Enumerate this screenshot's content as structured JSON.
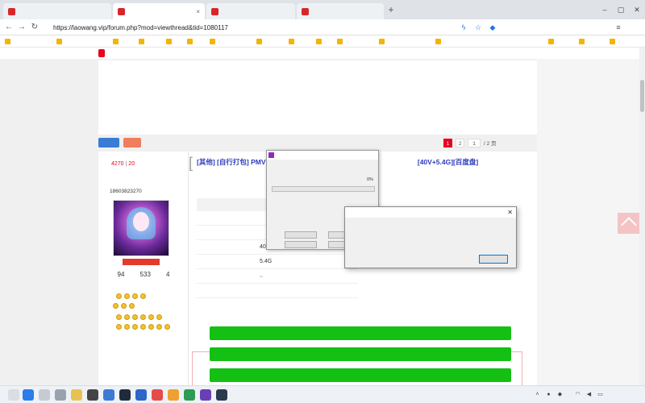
{
  "tabs": [
    {
      "title": ""
    },
    {
      "title": ""
    },
    {
      "title": ""
    },
    {
      "title": ""
    }
  ],
  "address": {
    "security": "",
    "url": "https://laowang.vip/forum.php?mod=viewthread&tid=1080117"
  },
  "bookmarks": [
    "",
    "",
    "",
    "",
    "",
    "",
    "",
    "",
    "",
    "",
    "",
    "",
    "",
    "",
    "",
    ""
  ],
  "site_nav": [
    "",
    "",
    "",
    "",
    "",
    "",
    "",
    "",
    "",
    "",
    "",
    "",
    "",
    "",
    "",
    "",
    "",
    ""
  ],
  "notice": {
    "lines": [
      "",
      "",
      "",
      "",
      ""
    ]
  },
  "actions": {
    "post": "",
    "reply": ""
  },
  "pager": {
    "back": "",
    "pages": [
      "1",
      "2"
    ],
    "input": "1",
    "total": "/ 2 页",
    "next": ""
  },
  "post": {
    "views_label": "",
    "views": "4270",
    "replies_label": "",
    "replies": "20",
    "tag": "[其他]",
    "title": "[自行打包] PMV",
    "title_tail": "[40V+5.4G][百度盘]",
    "copy_link": "",
    "author_id": "18603823270",
    "level": "",
    "user_stats": [
      {
        "value": "94",
        "label": ""
      },
      {
        "value": "533",
        "label": ""
      },
      {
        "value": "4",
        "label": ""
      }
    ],
    "meta": "",
    "floor": ""
  },
  "dl_info": {
    "header": "",
    "rows": [
      {
        "key": "",
        "value": ""
      },
      {
        "key": "",
        "value": ""
      },
      {
        "key": "",
        "value": "40V"
      },
      {
        "key": "",
        "value": "5.4G"
      },
      {
        "key": "",
        "value": ""
      },
      {
        "key": "",
        "value": ""
      }
    ]
  },
  "dl_links": {
    "header": "",
    "buttons": [
      "",
      "",
      ""
    ]
  },
  "progress_dialog": {
    "title": "",
    "path": "",
    "percent": "0%",
    "elapsed": "",
    "remaining": "",
    "mode": "",
    "buttons": [
      "",
      "",
      "",
      ""
    ]
  },
  "error_dialog": {
    "title": "",
    "message": "",
    "ok": ""
  },
  "taskbar": {
    "time": "",
    "date": ""
  },
  "colors": {
    "brand_red": "#e8001c",
    "link_blue": "#2c3cbd",
    "download_green": "#14c014"
  }
}
